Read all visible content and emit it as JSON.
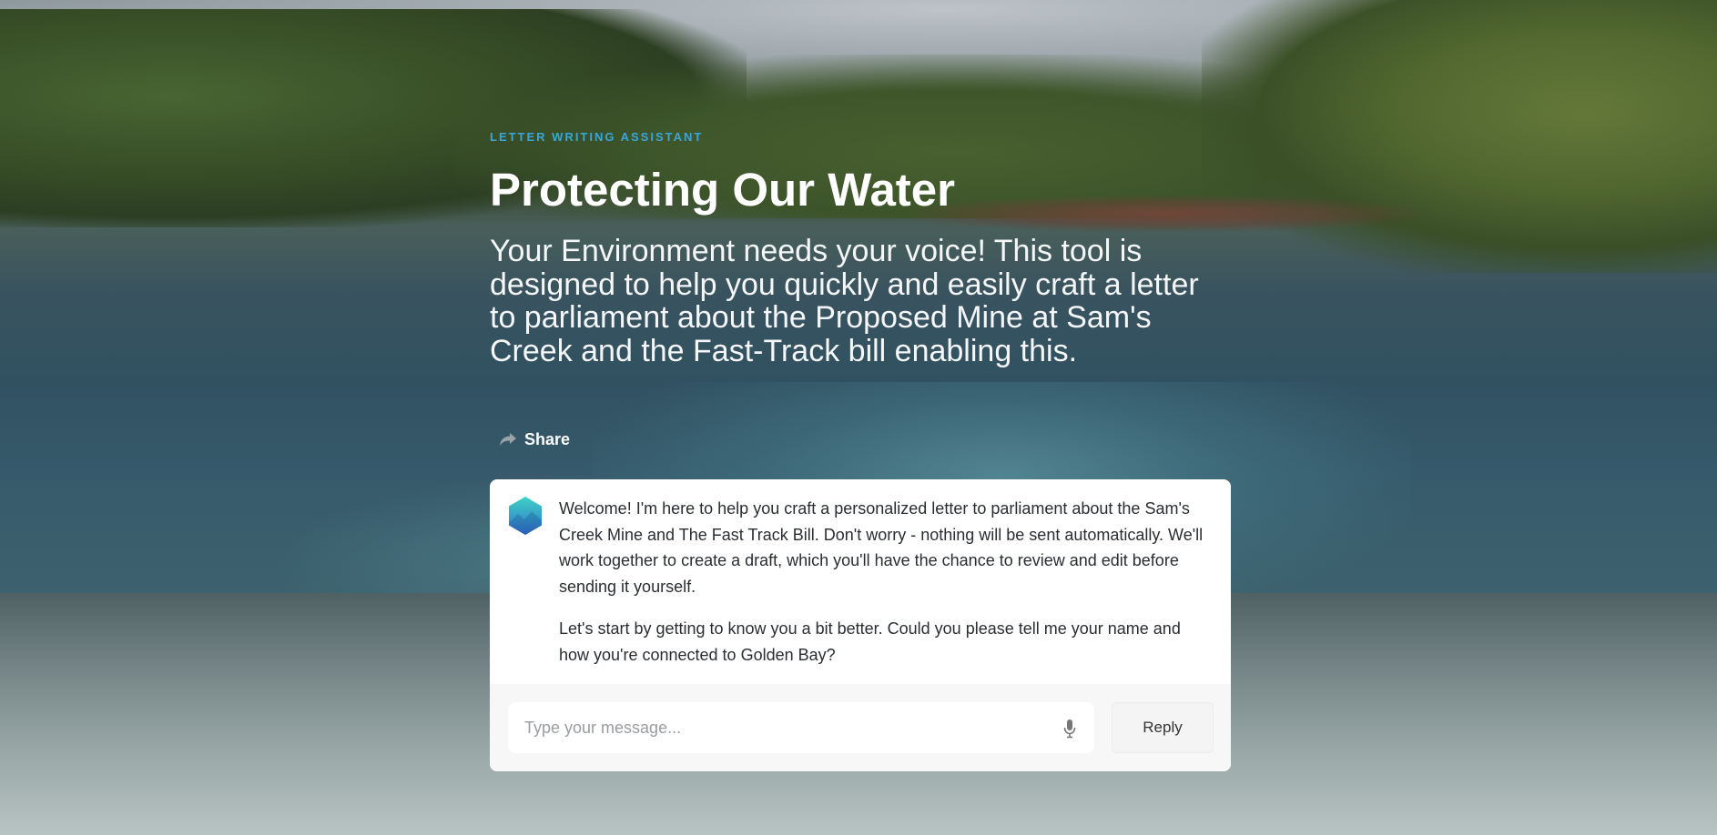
{
  "hero": {
    "kicker": "LETTER WRITING ASSISTANT",
    "title": "Protecting Our Water",
    "subtitle": "Your Environment needs your voice! This tool is designed to help you quickly and easily craft a letter to parliament about the Proposed Mine at Sam's Creek and the Fast-Track bill enabling this.",
    "share_label": "Share",
    "share_icon": "share-arrow-icon"
  },
  "chat": {
    "assistant_icon": "assistant-logo-icon",
    "messages": [
      "Welcome! I'm here to help you craft a personalized letter to parliament about the Sam's Creek Mine and The Fast Track Bill. Don't worry - nothing will be sent automatically. We'll work together to create a draft, which you'll have the chance to review and edit before sending it yourself.",
      "Let's start by getting to know you a bit better. Could you please tell me your name and how you're connected to Golden Bay?"
    ],
    "input_placeholder": "Type your message...",
    "input_value": "",
    "mic_icon": "microphone-icon",
    "reply_label": "Reply"
  },
  "colors": {
    "kicker": "#39a6d9",
    "card_bg": "#ffffff",
    "composer_bg": "#f7f7f7",
    "text": "#2a2e33"
  }
}
